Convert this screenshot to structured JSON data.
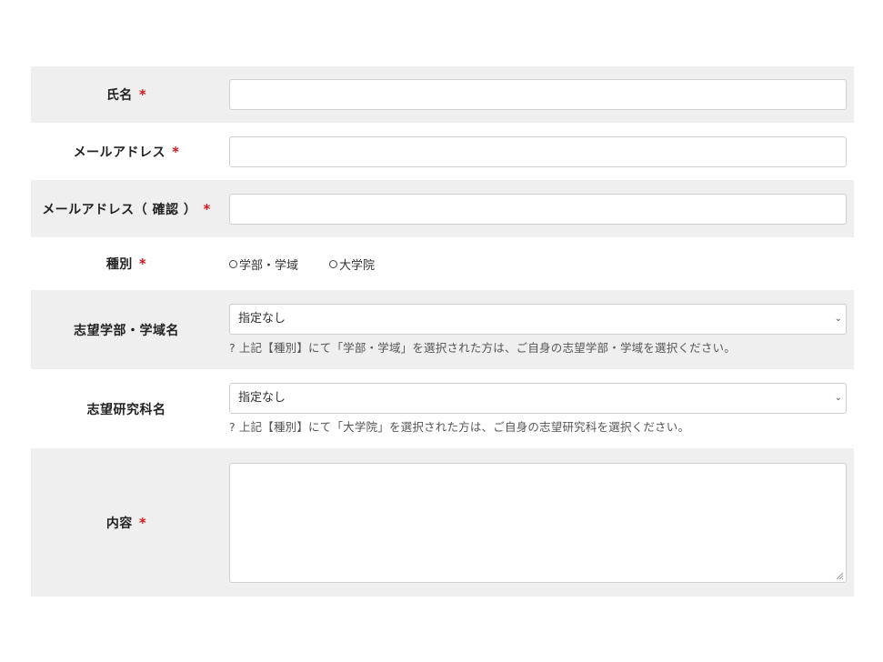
{
  "required_mark": "*",
  "fields": {
    "name": {
      "label": "氏名",
      "value": ""
    },
    "email": {
      "label": "メールアドレス",
      "value": ""
    },
    "email_confirm": {
      "label": "メールアドレス（ 確認 ）",
      "value": ""
    },
    "type": {
      "label": "種別",
      "options": [
        "学部・学域",
        "大学院"
      ]
    },
    "faculty": {
      "label": "志望学部・学域名",
      "selected": "指定なし",
      "hint": "上記【種別】にて「学部・学域」を選択された方は、ご自身の志望学部・学域を選択ください。"
    },
    "graduate": {
      "label": "志望研究科名",
      "selected": "指定なし",
      "hint": "上記【種別】にて「大学院」を選択された方は、ご自身の志望研究科を選択ください。"
    },
    "content": {
      "label": "内容",
      "value": ""
    }
  },
  "icons": {
    "help": "question-circle-icon",
    "dropdown": "chevron-down-icon"
  },
  "colors": {
    "required": "#d0191f",
    "row_shade": "#efefef"
  }
}
